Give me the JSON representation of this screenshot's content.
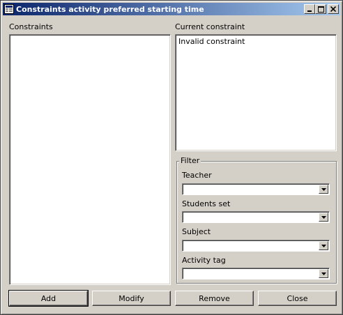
{
  "window": {
    "title": "Constraints activity preferred starting time",
    "controls": [
      "minimize-icon",
      "maximize-icon",
      "close-icon"
    ]
  },
  "constraints": {
    "label": "Constraints",
    "items": []
  },
  "current_constraint": {
    "label": "Current constraint",
    "text": "Invalid constraint"
  },
  "filter": {
    "title": "Filter",
    "teacher": {
      "label": "Teacher",
      "value": ""
    },
    "students_set": {
      "label": "Students set",
      "value": ""
    },
    "subject": {
      "label": "Subject",
      "value": ""
    },
    "activity_tag": {
      "label": "Activity tag",
      "value": ""
    }
  },
  "buttons": {
    "add": "Add",
    "modify": "Modify",
    "remove": "Remove",
    "close": "Close"
  }
}
